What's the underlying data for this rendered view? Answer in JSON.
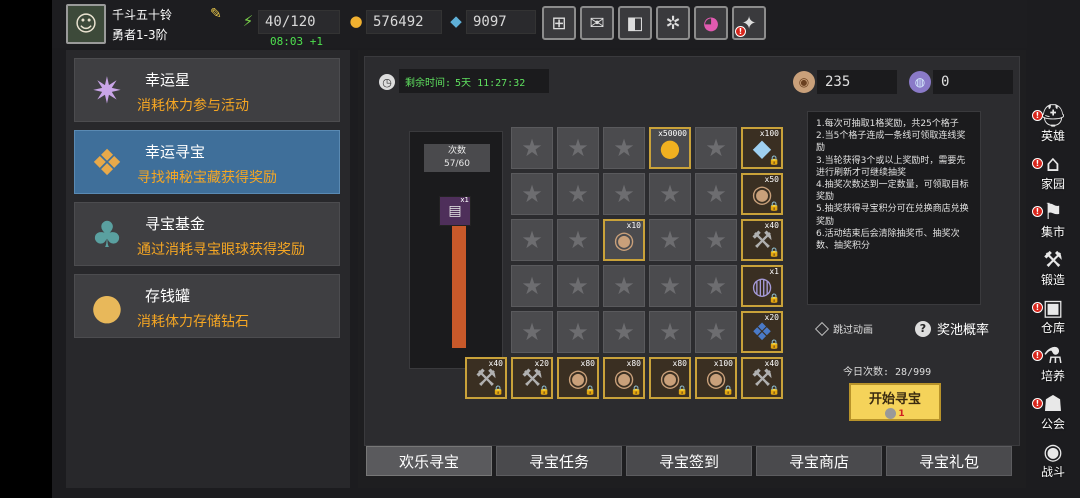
{
  "player": {
    "name": "千斗五十铃",
    "rank": "勇者1-3阶"
  },
  "resources": {
    "stamina": "40/120",
    "stamina_timer": "08:03 +1",
    "gold": "576492",
    "gems": "9097"
  },
  "top_buttons": [
    {
      "name": "shop",
      "icon": "cart-icon"
    },
    {
      "name": "mail",
      "icon": "mail-icon"
    },
    {
      "name": "gamepad",
      "icon": "gamepad-icon"
    },
    {
      "name": "settings",
      "icon": "gear-icon"
    },
    {
      "name": "wheel",
      "icon": "color-wheel-icon"
    },
    {
      "name": "news",
      "icon": "sparkle-icon"
    }
  ],
  "menu": [
    {
      "title": "幸运星",
      "desc": "消耗体力参与活动",
      "icon": "✷",
      "color": "#c9a5e8"
    },
    {
      "title": "幸运寻宝",
      "desc": "寻找神秘宝藏获得奖励",
      "icon": "❖",
      "color": "#e8a94a"
    },
    {
      "title": "寻宝基金",
      "desc": "通过消耗寻宝眼球获得奖励",
      "icon": "♣",
      "color": "#5aa0a0"
    },
    {
      "title": "存钱罐",
      "desc": "消耗体力存储钻石",
      "icon": "●",
      "color": "#e8b85a"
    }
  ],
  "panel": {
    "remain_label": "剩余时间:",
    "remain_value": "5天 11:27:32",
    "eggs": "235",
    "orbs": "0",
    "counter_label": "次数",
    "counter_value": "57/60",
    "counter_progress": 0.95,
    "counter_item_count": "x1",
    "instructions": [
      "1.每次可抽取1格奖励，共25个格子",
      "2.当5个格子连成一条线可领取连线奖励",
      "3.当轮获得3个或以上奖励时，需要先进行刷新才可继续抽奖",
      "4.抽奖次数达到一定数量，可领取目标奖励",
      "5.抽奖获得寻宝积分可在兑换商店兑换奖励",
      "6.活动结束后会清除抽奖币、抽奖次数、抽奖积分"
    ],
    "skip_label": "跳过动画",
    "odds_label": "奖池概率",
    "today_label": "今日次数: 28/999",
    "start_label": "开始寻宝",
    "start_cost": "1"
  },
  "grid": [
    [
      "star",
      "star",
      "star",
      "coin",
      "star"
    ],
    [
      "star",
      "star",
      "star",
      "star",
      "star"
    ],
    [
      "star",
      "star",
      "egg",
      "star",
      "star"
    ],
    [
      "star",
      "star",
      "star",
      "star",
      "star"
    ],
    [
      "star",
      "star",
      "star",
      "star",
      "star"
    ]
  ],
  "grid_revealed": {
    "coin": "x50000",
    "egg": "x10"
  },
  "row_rewards": [
    {
      "icon": "diamond",
      "count": "x100"
    },
    {
      "icon": "egg",
      "count": "x50"
    },
    {
      "icon": "hammer",
      "count": "x40"
    },
    {
      "icon": "orb",
      "count": "x1"
    },
    {
      "icon": "crystal",
      "count": "x20"
    }
  ],
  "col_rewards": [
    {
      "icon": "hammer",
      "count": "x40"
    },
    {
      "icon": "hammer",
      "count": "x20"
    },
    {
      "icon": "egg",
      "count": "x80"
    },
    {
      "icon": "egg",
      "count": "x80"
    },
    {
      "icon": "egg",
      "count": "x80"
    },
    {
      "icon": "egg",
      "count": "x100"
    },
    {
      "icon": "hammer",
      "count": "x40"
    }
  ],
  "tabs": [
    "欢乐寻宝",
    "寻宝任务",
    "寻宝签到",
    "寻宝商店",
    "寻宝礼包"
  ],
  "sidebar": [
    {
      "label": "英雄",
      "icon": "⛑",
      "badge": true
    },
    {
      "label": "家园",
      "icon": "⌂",
      "badge": true
    },
    {
      "label": "集市",
      "icon": "⚑",
      "badge": true
    },
    {
      "label": "锻造",
      "icon": "⚒",
      "badge": false
    },
    {
      "label": "仓库",
      "icon": "▣",
      "badge": true
    },
    {
      "label": "培养",
      "icon": "⚗",
      "badge": true
    },
    {
      "label": "公会",
      "icon": "☗",
      "badge": true
    },
    {
      "label": "战斗",
      "icon": "◉",
      "badge": false
    }
  ]
}
